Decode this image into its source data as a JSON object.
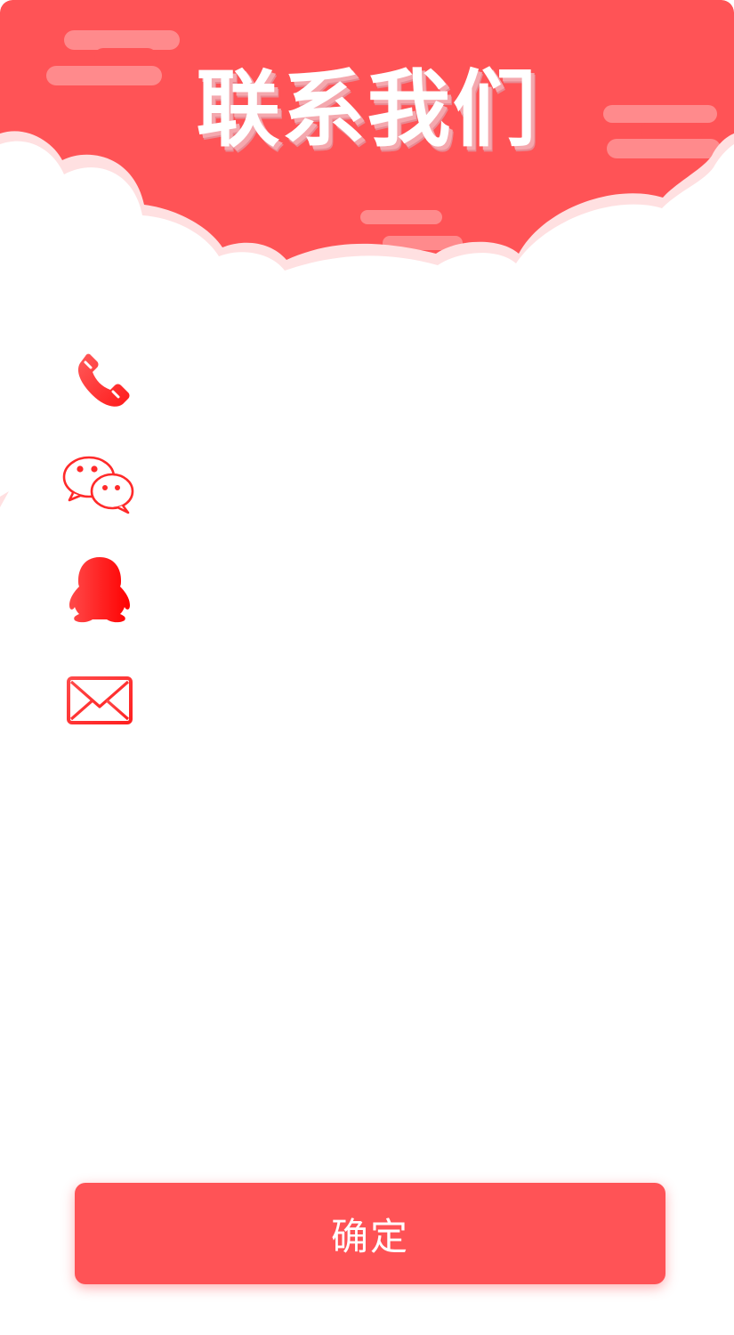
{
  "header": {
    "title": "联系我们"
  },
  "contacts": [
    {
      "icon": "phone-icon",
      "value": ""
    },
    {
      "icon": "wechat-icon",
      "value": ""
    },
    {
      "icon": "qq-icon",
      "value": ""
    },
    {
      "icon": "mail-icon",
      "value": ""
    }
  ],
  "footer": {
    "confirm_label": "确定"
  },
  "colors": {
    "primary": "#ff5356",
    "cloud_shadow": "#ffe0e1",
    "deco": "#ff8a8c"
  }
}
